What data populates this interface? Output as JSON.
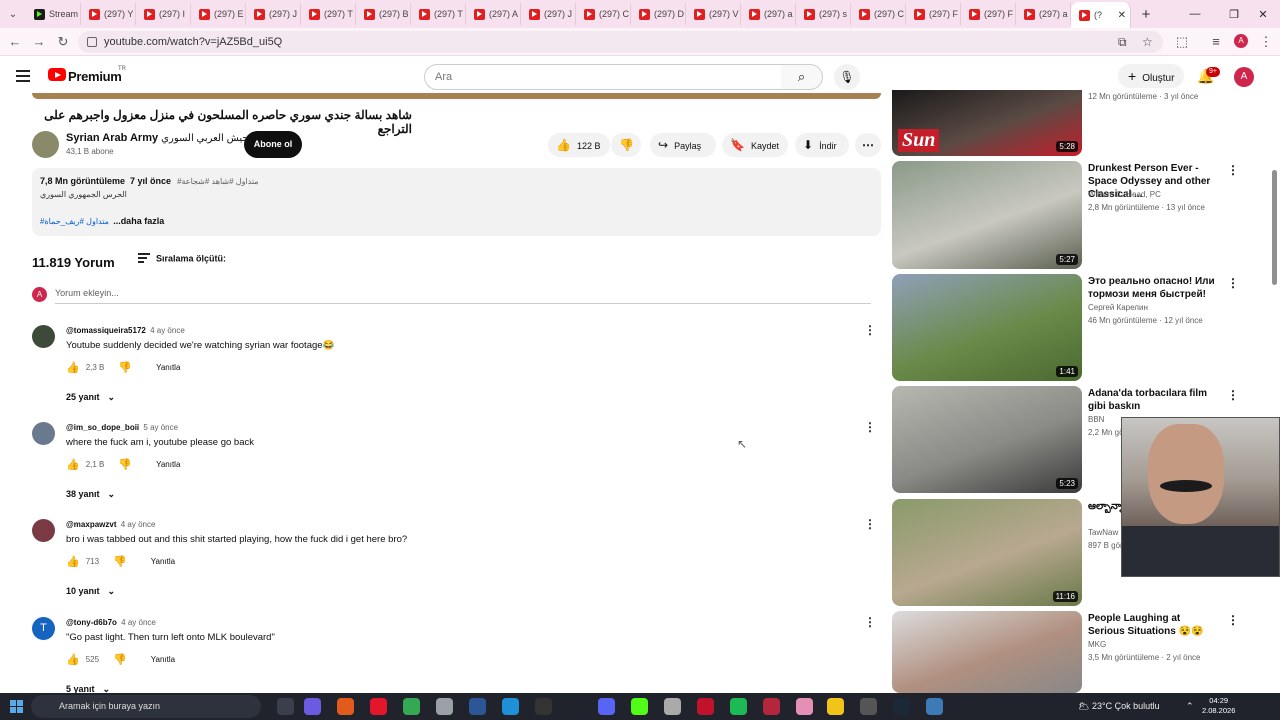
{
  "browser": {
    "tabs": [
      {
        "title": "Stream"
      },
      {
        "title": "(297) Y"
      },
      {
        "title": "(297) I"
      },
      {
        "title": "(297) E"
      },
      {
        "title": "(297) J"
      },
      {
        "title": "(297) T"
      },
      {
        "title": "(297) B"
      },
      {
        "title": "(297) T"
      },
      {
        "title": "(297) A"
      },
      {
        "title": "(297) J"
      },
      {
        "title": "(297) C"
      },
      {
        "title": "(297) D"
      },
      {
        "title": "(297) V"
      },
      {
        "title": "(297) a"
      },
      {
        "title": "(297) s"
      },
      {
        "title": "(297) C"
      },
      {
        "title": "(297) F"
      },
      {
        "title": "(297) F"
      },
      {
        "title": "(297) a"
      },
      {
        "title": "(?"
      }
    ],
    "url": "youtube.com/watch?v=jAZ5Bd_ui5Q",
    "profile_letter": "A"
  },
  "header": {
    "logo_text": "Premium",
    "country_code": "TR",
    "search_placeholder": "Ara",
    "create_label": "Oluştur",
    "notification_badge": "9+",
    "avatar_letter": "A"
  },
  "video": {
    "title": "شاهد بسالة جندي سوري حاصره المسلحون في منزل معزول واجبرهم على التراجع",
    "channel_name": "Syrian Arab Army",
    "channel_name_ar": "الجيش العربي السوري",
    "subscribers": "43,1 B abone",
    "subscribe_label": "Abone ol",
    "likes": "122 B",
    "share_label": "Paylaş",
    "save_label": "Kaydet",
    "download_label": "İndir",
    "views": "7,8 Mn görüntüleme",
    "age": "7 yıl önce",
    "hashtags": "#متداول #شاهد #شجاعة",
    "desc_line": "الحرس الجمهوري السوري",
    "desc_tags": "#متداول #ريف_حماة",
    "more_label": "...daha fazla"
  },
  "comments_section": {
    "count": "11.819 Yorum",
    "sort_label": "Sıralama ölçütü:",
    "add_placeholder": "Yorum ekleyin...",
    "my_avatar": "A",
    "reply_label": "Yanıtla",
    "comments": [
      {
        "handle": "@tomassiqueira5172",
        "time": "4 ay önce",
        "text": "Youtube suddenly decided we're watching syrian war footage😂",
        "likes": "2,3 B",
        "replies": "25 yanıt",
        "avatar_color": "#3d4a3a"
      },
      {
        "handle": "@im_so_dope_boii",
        "time": "5 ay önce",
        "text": "where the fuck am i, youtube please go back",
        "likes": "2,1 B",
        "replies": "38 yanıt",
        "avatar_color": "#6a7a8e"
      },
      {
        "handle": "@maxpawzvt",
        "time": "4 ay önce",
        "text": "bro i was tabbed out and this shit started playing, how the fuck did i get here bro?",
        "likes": "713",
        "replies": "10 yanıt",
        "avatar_color": "#7a3a44"
      },
      {
        "handle": "@tony-d6b7o",
        "time": "4 ay önce",
        "text": "\"Go past light. Then turn left onto MLK boulevard\"",
        "likes": "525",
        "replies": "5 yanıt",
        "avatar_color": "#1565c0",
        "avatar_letter": "T"
      }
    ]
  },
  "sidebar": {
    "videos": [
      {
        "title": "",
        "channel": "",
        "meta": "12 Mn görüntüleme · 3 yıl önce",
        "duration": "5:28",
        "thumb_label": "Sun",
        "colors": [
          "#1a1a1a",
          "#5a4a44",
          "#c41e2a"
        ]
      },
      {
        "title": "Drunkest Person Ever - Space Odyssey and other Classical ...",
        "channel": "William C. Head, PC",
        "meta": "2,8 Mn görüntüleme · 13 yıl önce",
        "duration": "5:27",
        "colors": [
          "#8a9a88",
          "#c9c8c0",
          "#5a6050"
        ]
      },
      {
        "title": "Это реально опасно! Или тормози меня быстрей!",
        "channel": "Сергей Карелин",
        "meta": "46 Mn görüntüleme · 12 yıl önce",
        "duration": "1:41",
        "colors": [
          "#8fa0b8",
          "#6a8a4a",
          "#4a6a30"
        ]
      },
      {
        "title": "Adana'da torbacılara film gibi baskın",
        "channel": "BBN",
        "meta": "2,2 Mn görüntüleme",
        "duration": "5:23",
        "colors": [
          "#b8b8b2",
          "#8a8a86",
          "#3a3a3a"
        ]
      },
      {
        "title": "ఆల్బాన్నా ఉలువా",
        "channel": "TawNaw",
        "meta": "897 B görüntüleme",
        "duration": "11:16",
        "colors": [
          "#8a9a6a",
          "#b8a890",
          "#6a7a4a"
        ]
      },
      {
        "title": "People Laughing at Serious Situations 😵😵",
        "channel": "MKG",
        "meta": "3,5 Mn görüntüleme · 2 yıl önce",
        "duration": "",
        "colors": [
          "#dcdcdc",
          "#b09080",
          "#888"
        ]
      }
    ]
  },
  "taskbar": {
    "search_placeholder": "Aramak için buraya yazın",
    "weather": "23°C  Çok bulutlu",
    "time": "04:29",
    "date": "2.08.2026"
  }
}
